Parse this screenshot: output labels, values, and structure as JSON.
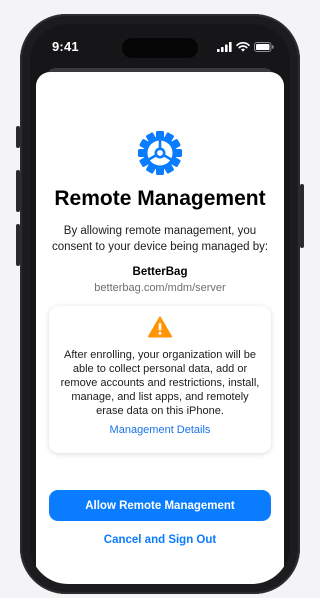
{
  "status_bar": {
    "time": "9:41"
  },
  "header": {
    "icon": "gear-icon",
    "title": "Remote Management",
    "intro": "By allowing remote management, you consent to your device being managed by:"
  },
  "organization": {
    "name": "BetterBag",
    "server_url": "betterbag.com/mdm/server"
  },
  "warning_card": {
    "icon": "warning-icon",
    "text": "After enrolling, your organization will be able to collect personal data, add or remove accounts and restrictions, install, manage, and list apps, and remotely erase data on this iPhone.",
    "link_label": "Management Details"
  },
  "actions": {
    "primary_label": "Allow Remote Management",
    "secondary_label": "Cancel and Sign Out"
  },
  "colors": {
    "accent": "#0a7cff",
    "warning": "#ff9500",
    "link": "#1a73e8"
  }
}
